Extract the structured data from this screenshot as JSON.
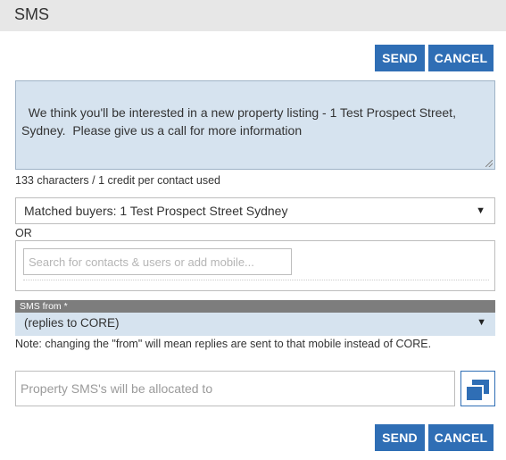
{
  "dialog": {
    "title": "SMS"
  },
  "actions": {
    "send_label": "SEND",
    "cancel_label": "CANCEL"
  },
  "message": {
    "text": "We think you'll be interested in a new property listing - 1 Test Prospect Street, Sydney.  Please give us a call for more information",
    "char_count_text": "133 characters / 1 credit per contact used"
  },
  "recipients": {
    "selected_group": "Matched buyers: 1 Test Prospect Street Sydney",
    "or_label": "OR",
    "search_placeholder": "Search for contacts & users or add mobile..."
  },
  "sms_from": {
    "header": "SMS from *",
    "selected": "(replies to CORE)",
    "note": "Note: changing the \"from\" will mean replies are sent to that mobile instead of CORE."
  },
  "allocation": {
    "placeholder": "Property SMS's will be allocated to"
  },
  "icons": {
    "dropdown": "caret-down-icon",
    "allocate": "windows-icon"
  },
  "colors": {
    "accent": "#2f6eb5",
    "field_bg": "#d6e3ef",
    "header_bg": "#7d7d7d",
    "title_bar": "#e7e7e7"
  }
}
